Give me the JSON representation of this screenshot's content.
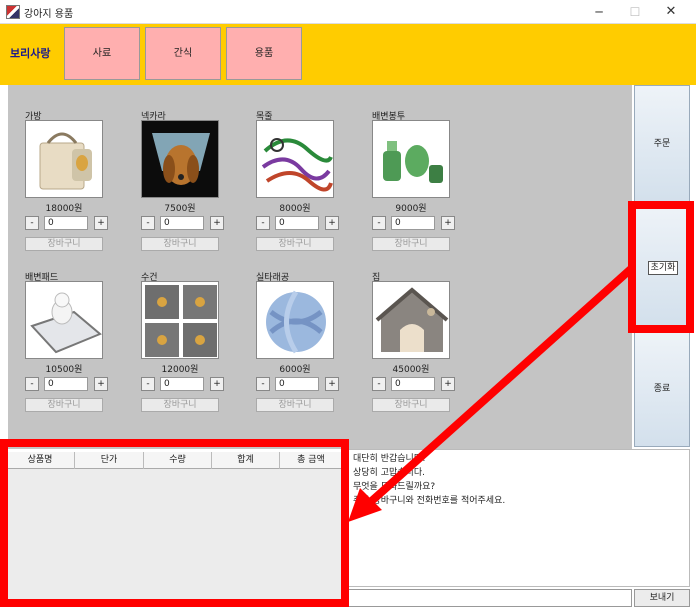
{
  "window": {
    "title": "강아지 용품",
    "min_icon": "─",
    "max_icon": "☐",
    "close_icon": "✕"
  },
  "header": {
    "brand": "보리사랑",
    "tabs": [
      "사료",
      "간식",
      "용품"
    ]
  },
  "products": [
    {
      "name": "가방",
      "price": "18000원",
      "qty": "0",
      "icon": "bag-image"
    },
    {
      "name": "넥카라",
      "price": "7500원",
      "qty": "0",
      "icon": "collar-image"
    },
    {
      "name": "목줄",
      "price": "8000원",
      "qty": "0",
      "icon": "leash-image"
    },
    {
      "name": "배변봉투",
      "price": "9000원",
      "qty": "0",
      "icon": "poop-bag-image"
    },
    {
      "name": "배변패드",
      "price": "10500원",
      "qty": "0",
      "icon": "pad-image"
    },
    {
      "name": "수건",
      "price": "12000원",
      "qty": "0",
      "icon": "towel-image"
    },
    {
      "name": "실타래공",
      "price": "6000원",
      "qty": "0",
      "icon": "yarn-ball-image"
    },
    {
      "name": "집",
      "price": "45000원",
      "qty": "0",
      "icon": "dog-house-image"
    }
  ],
  "controls": {
    "minus": "-",
    "plus": "+",
    "cart": "장바구니"
  },
  "side": {
    "order": "주문",
    "reset": "초기화",
    "exit": "종료"
  },
  "table": {
    "headers": [
      "상품명",
      "단가",
      "수량",
      "합계",
      "총 금액"
    ]
  },
  "chat": {
    "lines": [
      "대단히 반갑습니다!",
      "상당히 고맙습니다.",
      "무엇을 도와드릴까요?",
      "주문 장바구니와 전화번호를 적어주세요."
    ]
  },
  "footer": {
    "send": "보내기",
    "message_value": ""
  },
  "colors": {
    "header": "#ffcc00",
    "tab": "#ffafaf",
    "panel": "#c4c4c4",
    "annotation": "#ff0000",
    "brand": "#1a1a8c"
  }
}
